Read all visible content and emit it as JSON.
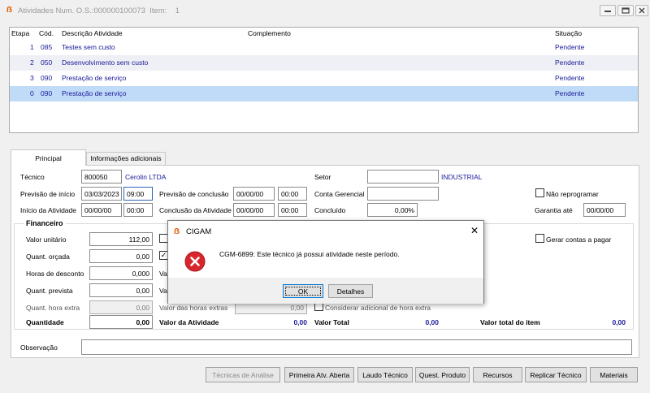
{
  "window": {
    "title": "Atividades Num. O.S.:000000100073  Item:    1"
  },
  "grid": {
    "headers": {
      "etapa": "Etapa",
      "cod": "Cód.",
      "descricao": "Descrição Atividade",
      "complemento": "Complemento",
      "situacao": "Situação"
    },
    "rows": [
      {
        "etapa": "1",
        "cod": "085",
        "descricao": "Testes sem custo",
        "complemento": "",
        "situacao": "Pendente"
      },
      {
        "etapa": "2",
        "cod": "050",
        "descricao": "Desenvolvimento sem custo",
        "complemento": "",
        "situacao": "Pendente"
      },
      {
        "etapa": "3",
        "cod": "090",
        "descricao": "Prestação de serviço",
        "complemento": "",
        "situacao": "Pendente"
      },
      {
        "etapa": "0",
        "cod": "090",
        "descricao": "Prestação de serviço",
        "complemento": "",
        "situacao": "Pendente"
      }
    ]
  },
  "tabs": {
    "principal": "Principal",
    "info": "Informações adicionais"
  },
  "form": {
    "tecnico_label": "Técnico",
    "tecnico_code": "800050",
    "tecnico_name": "Cerolin LTDA",
    "setor_label": "Setor",
    "setor_value": "",
    "setor_name": "INDUSTRIAL",
    "prev_inicio_label": "Previsão de início",
    "prev_inicio_date": "03/03/2023",
    "prev_inicio_time": "09:00",
    "prev_conclusao_label": "Previsão de conclusão",
    "prev_conclusao_date": "00/00/00",
    "prev_conclusao_time": "00:00",
    "conta_gerencial_label": "Conta Gerencial",
    "conta_gerencial_value": "",
    "nao_reprogramar_label": "Não reprogramar",
    "inicio_label": "Início da Atividade",
    "inicio_date": "00/00/00",
    "inicio_time": "00:00",
    "conclusao_label": "Conclusão da Atividade",
    "conclusao_date": "00/00/00",
    "conclusao_time": "00:00",
    "concluido_label": "Concluído",
    "concluido_value": "0,00%",
    "garantia_label": "Garantia até",
    "garantia_value": "00/00/00"
  },
  "financeiro": {
    "caption": "Financeiro",
    "valor_unitario_label": "Valor unitário",
    "valor_unitario": "112,00",
    "quant_orcada_label": "Quant. orçada",
    "quant_orcada": "0,00",
    "horas_desconto_label": "Horas de desconto",
    "horas_desconto": "0,000",
    "quant_prevista_label": "Quant. prevista",
    "quant_prevista": "0,00",
    "quant_hora_extra_label": "Quant. hora extra",
    "quant_hora_extra": "0,00",
    "valor_horas_extras_label": "Valor das horas extras",
    "valor_horas_extras": "0,00",
    "considerar_adicional_label": "Considerar adicional de hora extra",
    "gerar_contas_label": "Gerar contas a pagar",
    "va_fragment": "Va",
    "quantidade_label": "Quantidade",
    "quantidade": "0,00",
    "valor_atividade_label": "Valor da Atividade",
    "valor_atividade": "0,00",
    "valor_total_label": "Valor Total",
    "valor_total": "0,00",
    "valor_total_item_label": "Valor total do item",
    "valor_total_item": "0,00"
  },
  "observacao": {
    "label": "Observação",
    "value": ""
  },
  "buttons": {
    "tecnicas": "Técnicas de Análise",
    "primeira": "Primeira Atv. Aberta",
    "laudo": "Laudo Técnico",
    "quest": "Quest. Produto",
    "recursos": "Recursos",
    "replicar": "Replicar Técnico",
    "materiais": "Materiais"
  },
  "dialog": {
    "title": "CIGAM",
    "message": "CGM-6899: Este técnico já possui atividade neste período.",
    "ok": "OK",
    "detalhes": "Detalhes"
  },
  "colors": {
    "accent": "#1a1a9a",
    "selection": "#bfdbf7",
    "error": "#d9262d",
    "brand": "#e05a00"
  }
}
